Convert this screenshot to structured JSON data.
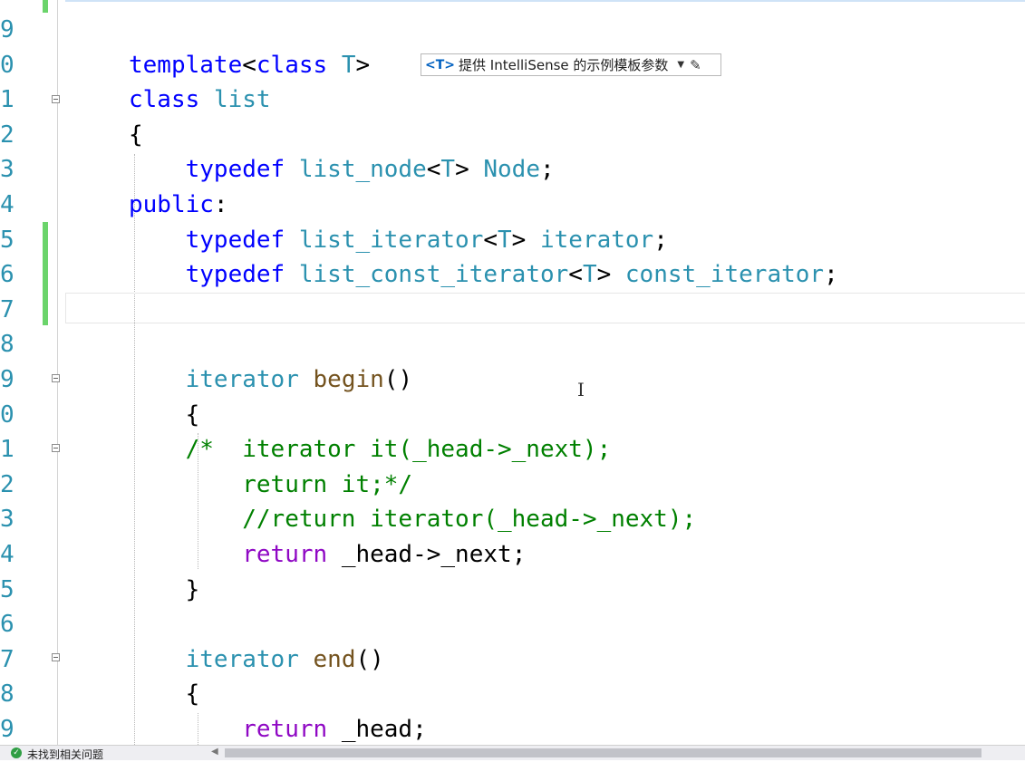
{
  "editor": {
    "line_numbers": [
      "9",
      "0",
      "1",
      "2",
      "3",
      "4",
      "5",
      "6",
      "7",
      "8",
      "9",
      "0",
      "1",
      "2",
      "3",
      "4",
      "5",
      "6",
      "7",
      "8",
      "9"
    ],
    "lines": [
      [],
      [
        {
          "t": "template",
          "c": "kw"
        },
        {
          "t": "<",
          "c": ""
        },
        {
          "t": "class",
          "c": "kw"
        },
        {
          "t": " ",
          "c": ""
        },
        {
          "t": "T",
          "c": "kw2"
        },
        {
          "t": ">",
          "c": ""
        }
      ],
      [
        {
          "t": "class",
          "c": "kw"
        },
        {
          "t": " ",
          "c": ""
        },
        {
          "t": "list",
          "c": "kw2"
        }
      ],
      [
        {
          "t": "{",
          "c": ""
        }
      ],
      [
        {
          "t": "    ",
          "c": ""
        },
        {
          "t": "typedef",
          "c": "kw"
        },
        {
          "t": " ",
          "c": ""
        },
        {
          "t": "list_node",
          "c": "kw2"
        },
        {
          "t": "<",
          "c": ""
        },
        {
          "t": "T",
          "c": "kw2"
        },
        {
          "t": "> ",
          "c": ""
        },
        {
          "t": "Node",
          "c": "kw2"
        },
        {
          "t": ";",
          "c": ""
        }
      ],
      [
        {
          "t": "public",
          "c": "kw"
        },
        {
          "t": ":",
          "c": ""
        }
      ],
      [
        {
          "t": "    ",
          "c": ""
        },
        {
          "t": "typedef",
          "c": "kw"
        },
        {
          "t": " ",
          "c": ""
        },
        {
          "t": "list_iterator",
          "c": "kw2"
        },
        {
          "t": "<",
          "c": ""
        },
        {
          "t": "T",
          "c": "kw2"
        },
        {
          "t": "> ",
          "c": ""
        },
        {
          "t": "iterator",
          "c": "kw2"
        },
        {
          "t": ";",
          "c": ""
        }
      ],
      [
        {
          "t": "    ",
          "c": ""
        },
        {
          "t": "typedef",
          "c": "kw"
        },
        {
          "t": " ",
          "c": ""
        },
        {
          "t": "list_const_iterator",
          "c": "kw2"
        },
        {
          "t": "<",
          "c": ""
        },
        {
          "t": "T",
          "c": "kw2"
        },
        {
          "t": "> ",
          "c": ""
        },
        {
          "t": "const_iterator",
          "c": "kw2"
        },
        {
          "t": ";",
          "c": ""
        }
      ],
      [],
      [],
      [
        {
          "t": "    ",
          "c": ""
        },
        {
          "t": "iterator",
          "c": "kw2"
        },
        {
          "t": " ",
          "c": ""
        },
        {
          "t": "begin",
          "c": "fn"
        },
        {
          "t": "()",
          "c": ""
        }
      ],
      [
        {
          "t": "    {",
          "c": ""
        }
      ],
      [
        {
          "t": "    ",
          "c": ""
        },
        {
          "t": "/*  iterator it(_head->_next);",
          "c": "cm"
        }
      ],
      [
        {
          "t": "        ",
          "c": ""
        },
        {
          "t": "return it;*/",
          "c": "cm"
        }
      ],
      [
        {
          "t": "        ",
          "c": ""
        },
        {
          "t": "//return iterator(_head->_next);",
          "c": "cm"
        }
      ],
      [
        {
          "t": "        ",
          "c": ""
        },
        {
          "t": "return",
          "c": "ret"
        },
        {
          "t": " ",
          "c": ""
        },
        {
          "t": "_head",
          "c": ""
        },
        {
          "t": "->",
          "c": ""
        },
        {
          "t": "_next",
          "c": ""
        },
        {
          "t": ";",
          "c": ""
        }
      ],
      [
        {
          "t": "    }",
          "c": ""
        }
      ],
      [],
      [
        {
          "t": "    ",
          "c": ""
        },
        {
          "t": "iterator",
          "c": "kw2"
        },
        {
          "t": " ",
          "c": ""
        },
        {
          "t": "end",
          "c": "fn"
        },
        {
          "t": "()",
          "c": ""
        }
      ],
      [
        {
          "t": "    {",
          "c": ""
        }
      ],
      [
        {
          "t": "        ",
          "c": ""
        },
        {
          "t": "return",
          "c": "ret"
        },
        {
          "t": " ",
          "c": ""
        },
        {
          "t": "_head",
          "c": ""
        },
        {
          "t": ";",
          "c": ""
        }
      ]
    ]
  },
  "hint": {
    "badge": "<T>",
    "text": "提供 IntelliSense 的示例模板参数",
    "dropdown_icon": "chevron-down-icon",
    "edit_icon": "pencil-icon"
  },
  "statusbar": {
    "message": "未找到相关问题",
    "status_icon": "check-circle-icon"
  }
}
